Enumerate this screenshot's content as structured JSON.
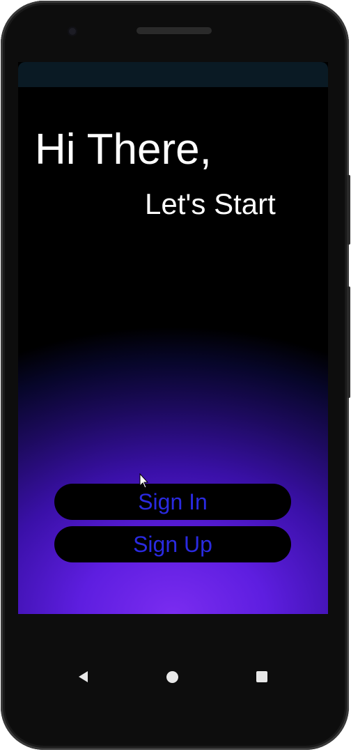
{
  "greeting": {
    "title": "Hi There,",
    "subtitle": "Let's Start"
  },
  "actions": {
    "sign_in_label": "Sign In",
    "sign_up_label": "Sign Up"
  },
  "colors": {
    "button_text": "#2a2ae0",
    "glow_center": "#7a2cf0",
    "background": "#000000"
  },
  "navigation": {
    "icons": [
      "back-icon",
      "home-icon",
      "recents-icon"
    ]
  }
}
